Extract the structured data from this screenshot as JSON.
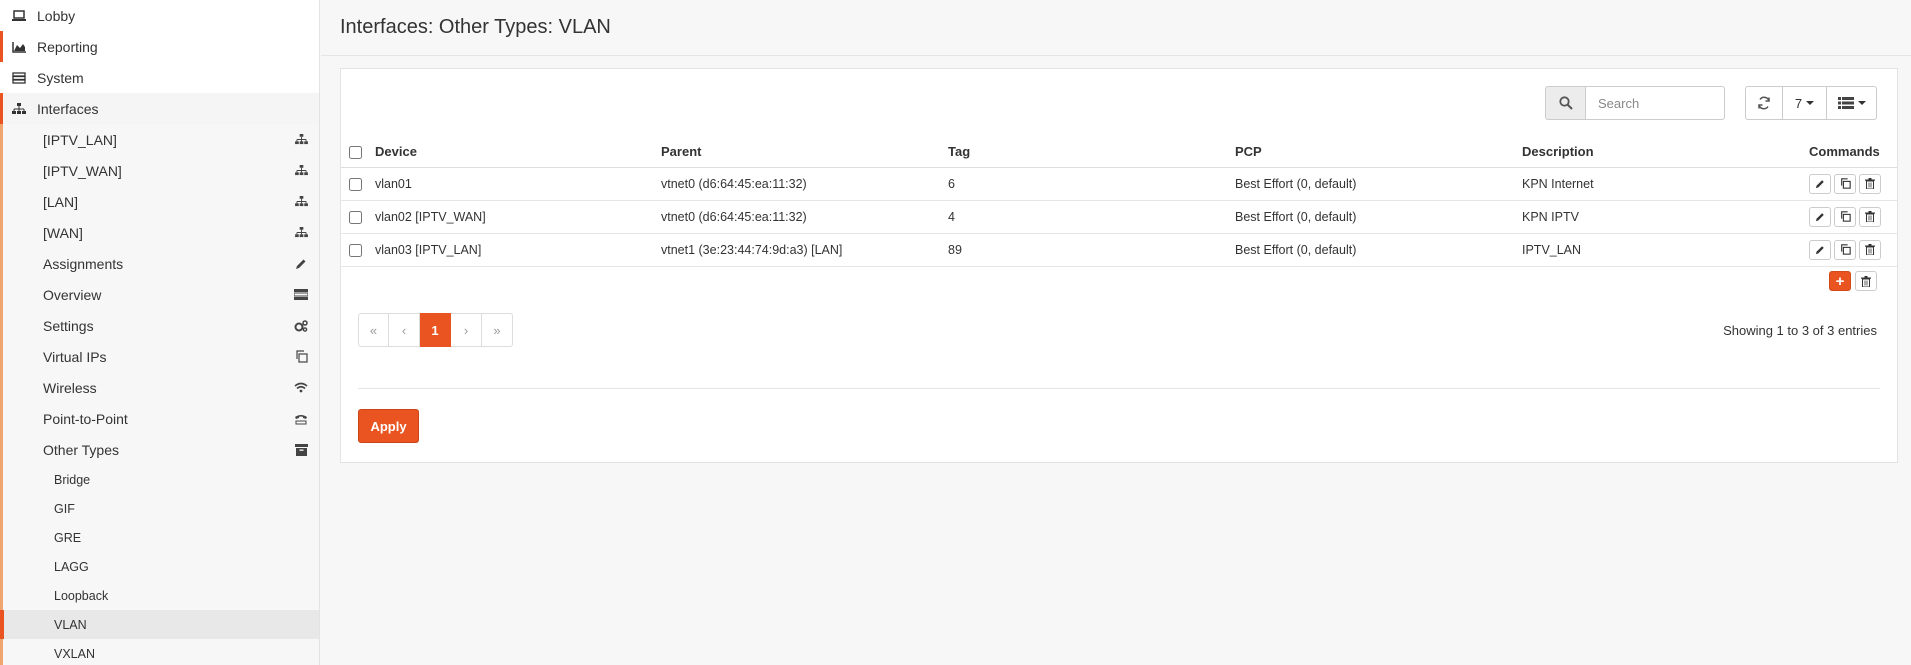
{
  "sidebar": {
    "top_items": [
      {
        "label": "Lobby",
        "icon": "laptop-icon"
      },
      {
        "label": "Reporting",
        "icon": "area-chart-icon"
      },
      {
        "label": "System",
        "icon": "server-icon"
      },
      {
        "label": "Interfaces",
        "icon": "sitemap-icon"
      }
    ],
    "interface_items": [
      {
        "label": "[IPTV_LAN]",
        "icon": "sitemap-icon"
      },
      {
        "label": "[IPTV_WAN]",
        "icon": "sitemap-icon"
      },
      {
        "label": "[LAN]",
        "icon": "sitemap-icon"
      },
      {
        "label": "[WAN]",
        "icon": "sitemap-icon"
      },
      {
        "label": "Assignments",
        "icon": "pencil-icon"
      },
      {
        "label": "Overview",
        "icon": "tasks-icon"
      },
      {
        "label": "Settings",
        "icon": "cogs-icon"
      },
      {
        "label": "Virtual IPs",
        "icon": "clone-icon"
      },
      {
        "label": "Wireless",
        "icon": "wifi-icon"
      },
      {
        "label": "Point-to-Point",
        "icon": "tty-icon"
      },
      {
        "label": "Other Types",
        "icon": "archive-icon"
      }
    ],
    "other_types": [
      "Bridge",
      "GIF",
      "GRE",
      "LAGG",
      "Loopback",
      "VLAN",
      "VXLAN"
    ],
    "active_other_type": "VLAN"
  },
  "page": {
    "title": "Interfaces: Other Types: VLAN"
  },
  "toolbar": {
    "search_placeholder": "Search",
    "page_size": "7"
  },
  "table": {
    "headers": {
      "device": "Device",
      "parent": "Parent",
      "tag": "Tag",
      "pcp": "PCP",
      "description": "Description",
      "commands": "Commands"
    },
    "rows": [
      {
        "device": "vlan01",
        "parent": "vtnet0 (d6:64:45:ea:11:32)",
        "tag": "6",
        "pcp": "Best Effort (0, default)",
        "description": "KPN Internet"
      },
      {
        "device": "vlan02 [IPTV_WAN]",
        "parent": "vtnet0 (d6:64:45:ea:11:32)",
        "tag": "4",
        "pcp": "Best Effort (0, default)",
        "description": "KPN IPTV"
      },
      {
        "device": "vlan03 [IPTV_LAN]",
        "parent": "vtnet1 (3e:23:44:74:9d:a3) [LAN]",
        "tag": "89",
        "pcp": "Best Effort (0, default)",
        "description": "IPTV_LAN"
      }
    ]
  },
  "pagination": {
    "first": "«",
    "prev": "‹",
    "current": "1",
    "next": "›",
    "last": "»",
    "info": "Showing 1 to 3 of 3 entries"
  },
  "actions": {
    "apply_label": "Apply",
    "add_symbol": "+"
  },
  "colors": {
    "accent": "#E95420",
    "accent_light": "#f0a470"
  }
}
